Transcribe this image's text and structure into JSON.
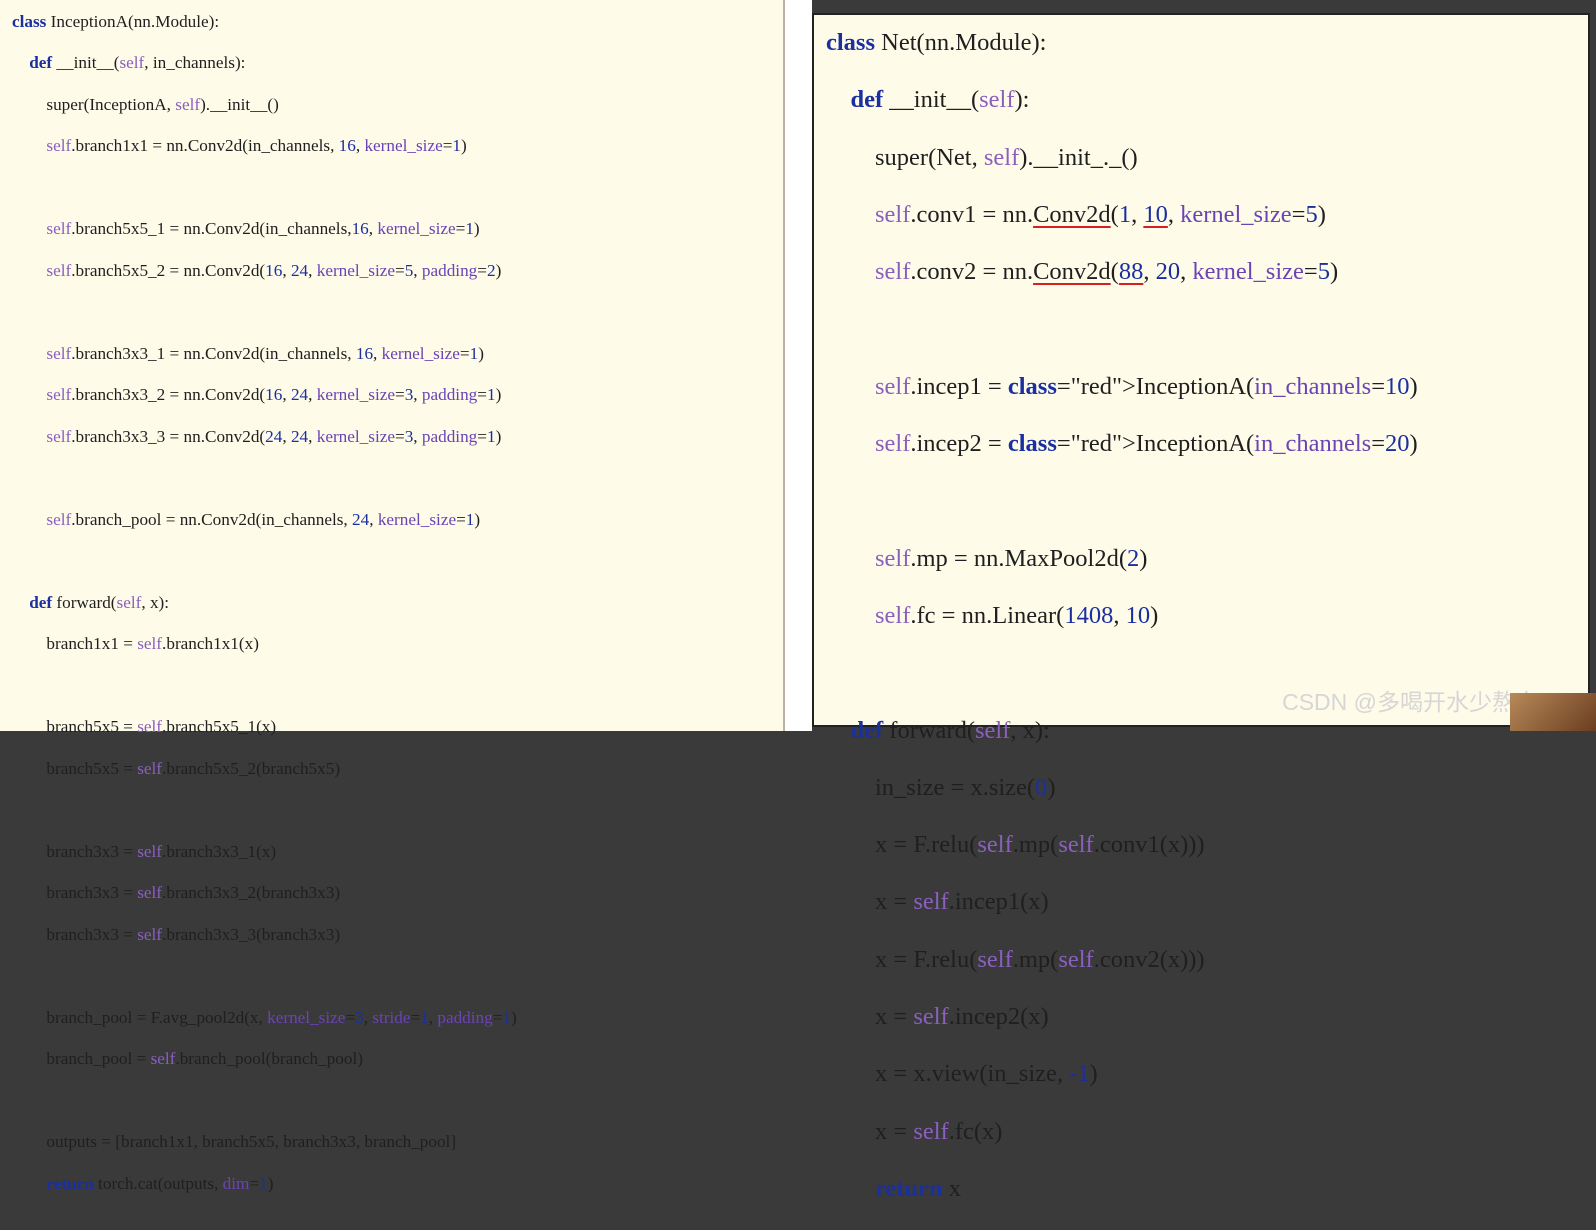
{
  "left": {
    "lines": [
      "class InceptionA(nn.Module):",
      "    def __init__(self, in_channels):",
      "        super(InceptionA, self).__init__()",
      "        self.branch1x1 = nn.Conv2d(in_channels, 16, kernel_size=1)",
      "",
      "        self.branch5x5_1 = nn.Conv2d(in_channels,16, kernel_size=1)",
      "        self.branch5x5_2 = nn.Conv2d(16, 24, kernel_size=5, padding=2)",
      "",
      "        self.branch3x3_1 = nn.Conv2d(in_channels, 16, kernel_size=1)",
      "        self.branch3x3_2 = nn.Conv2d(16, 24, kernel_size=3, padding=1)",
      "        self.branch3x3_3 = nn.Conv2d(24, 24, kernel_size=3, padding=1)",
      "",
      "        self.branch_pool = nn.Conv2d(in_channels, 24, kernel_size=1)",
      "",
      "    def forward(self, x):",
      "        branch1x1 = self.branch1x1(x)",
      "",
      "        branch5x5 = self.branch5x5_1(x)",
      "        branch5x5 = self.branch5x5_2(branch5x5)",
      "",
      "        branch3x3 = self.branch3x3_1(x)",
      "        branch3x3 = self.branch3x3_2(branch3x3)",
      "        branch3x3 = self.branch3x3_3(branch3x3)",
      "",
      "        branch_pool = F.avg_pool2d(x, kernel_size=3, stride=1, padding=1)",
      "        branch_pool = self.branch_pool(branch_pool)",
      "",
      "        outputs = [branch1x1, branch5x5, branch3x3, branch_pool]",
      "        return torch.cat(outputs, dim=1)"
    ]
  },
  "right": {
    "lines": [
      "class Net(nn.Module):",
      "    def __init__(self):",
      "        super(Net, self).__init_._()",
      "        self.conv1 = nn.Conv2d(1, 10, kernel_size=5)",
      "        self.conv2 = nn.Conv2d(88, 20, kernel_size=5)",
      "",
      "        self.incep1 = InceptionA(in_channels=10)",
      "        self.incep2 = InceptionA(in_channels=20)",
      "",
      "        self.mp = nn.MaxPool2d(2)",
      "        self.fc = nn.Linear(1408, 10)",
      "",
      "    def forward(self, x):",
      "        in_size = x.size(0)",
      "        x = F.relu(self.mp(self.conv1(x)))",
      "        x = self.incep1(x)",
      "        x = F.relu(self.mp(self.conv2(x)))",
      "        x = self.incep2(x)",
      "        x = x.view(in_size, -1)",
      "        x = self.fc(x)",
      "        return x"
    ]
  },
  "watermark": "CSDN @多喝开水少熬夜",
  "colors": {
    "keyword": "#1a2fa0",
    "self": "#8a5fbe",
    "highlight_red": "#d42020",
    "background": "#fefbe9"
  }
}
